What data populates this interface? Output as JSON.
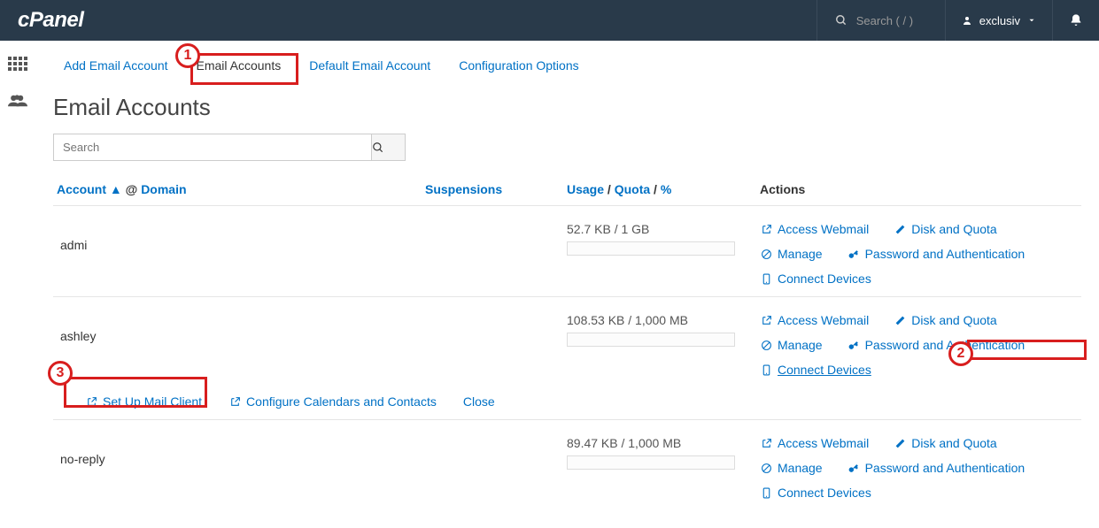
{
  "brand": "cPanel",
  "topbar": {
    "search_placeholder": "Search ( / )",
    "user": "exclusiv"
  },
  "tabs": {
    "add": "Add Email Account",
    "accounts": "Email Accounts",
    "default": "Default Email Account",
    "config": "Configuration Options"
  },
  "page_title": "Email Accounts",
  "search": {
    "placeholder": "Search"
  },
  "columns": {
    "account": "Account",
    "at": "@",
    "domain": "Domain",
    "suspensions": "Suspensions",
    "usage": "Usage",
    "quota": "Quota",
    "percent": "%",
    "actions": "Actions"
  },
  "actions": {
    "access_webmail": "Access Webmail",
    "disk_quota": "Disk and Quota",
    "manage": "Manage",
    "password_auth": "Password and Authentication",
    "connect_devices": "Connect Devices",
    "setup_mail": "Set Up Mail Client",
    "configure_cal": "Configure Calendars and Contacts",
    "close": "Close"
  },
  "rows": [
    {
      "account": "admi",
      "usage": "52.7 KB / 1 GB"
    },
    {
      "account": "ashley",
      "usage": "108.53 KB / 1,000 MB"
    },
    {
      "account": "no-reply",
      "usage": "89.47 KB / 1,000 MB"
    }
  ],
  "markers": {
    "m1": "1",
    "m2": "2",
    "m3": "3"
  },
  "sort_arrow": "▲"
}
